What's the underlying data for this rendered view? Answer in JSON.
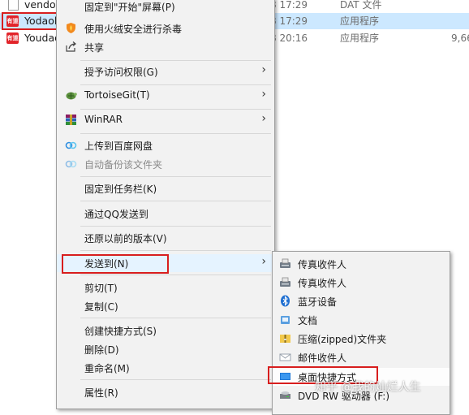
{
  "files": [
    {
      "name": "vendor",
      "date": "8 17:29",
      "type": "DAT 文件",
      "size": "",
      "icon": "dat-file-icon"
    },
    {
      "name": "Yodaol",
      "date": "8 17:29",
      "type": "应用程序",
      "size": "",
      "icon": "youdao-app-icon"
    },
    {
      "name": "Youdao",
      "date": "8 20:16",
      "type": "应用程序",
      "size": "9,66",
      "icon": "youdao-app-icon"
    }
  ],
  "app_icon_text": "有道",
  "context_menu": {
    "items": [
      {
        "label": "固定到\"开始\"屏幕(P)"
      },
      {
        "label": "使用火绒安全进行杀毒",
        "icon": "huorong-shield-icon"
      },
      {
        "label": "共享",
        "icon": "share-icon"
      },
      {
        "label": "授予访问权限(G)",
        "arrow": "›"
      },
      {
        "label": "TortoiseGit(T)",
        "icon": "tortoisegit-icon",
        "arrow": "›"
      },
      {
        "label": "WinRAR",
        "icon": "winrar-icon",
        "arrow": "›"
      },
      {
        "label": "上传到百度网盘",
        "icon": "baidu-netdisk-icon"
      },
      {
        "label": "自动备份该文件夹",
        "icon": "baidu-netdisk-icon",
        "disabled": true
      },
      {
        "label": "固定到任务栏(K)"
      },
      {
        "label": "通过QQ发送到"
      },
      {
        "label": "还原以前的版本(V)"
      },
      {
        "label": "发送到(N)",
        "arrow": "›"
      },
      {
        "label": "剪切(T)"
      },
      {
        "label": "复制(C)"
      },
      {
        "label": "创建快捷方式(S)"
      },
      {
        "label": "删除(D)"
      },
      {
        "label": "重命名(M)"
      },
      {
        "label": "属性(R)"
      }
    ]
  },
  "send_to_menu": {
    "items": [
      {
        "label": "传真收件人",
        "icon": "fax-icon"
      },
      {
        "label": "传真收件人",
        "icon": "fax-icon"
      },
      {
        "label": "蓝牙设备",
        "icon": "bluetooth-icon"
      },
      {
        "label": "文档",
        "icon": "documents-icon"
      },
      {
        "label": "压缩(zipped)文件夹",
        "icon": "zip-folder-icon"
      },
      {
        "label": "邮件收件人",
        "icon": "mail-icon"
      },
      {
        "label": "桌面快捷方式",
        "icon": "desktop-icon"
      },
      {
        "label": "DVD RW 驱动器 (F:)",
        "icon": "dvd-drive-icon"
      }
    ]
  },
  "watermark": "知乎 @我的灿烂人生",
  "colors": {
    "selection": "#cce8ff",
    "highlight_box": "#d81e1e",
    "menu_bg": "#f2f2f2",
    "app_icon": "#e2242a"
  }
}
